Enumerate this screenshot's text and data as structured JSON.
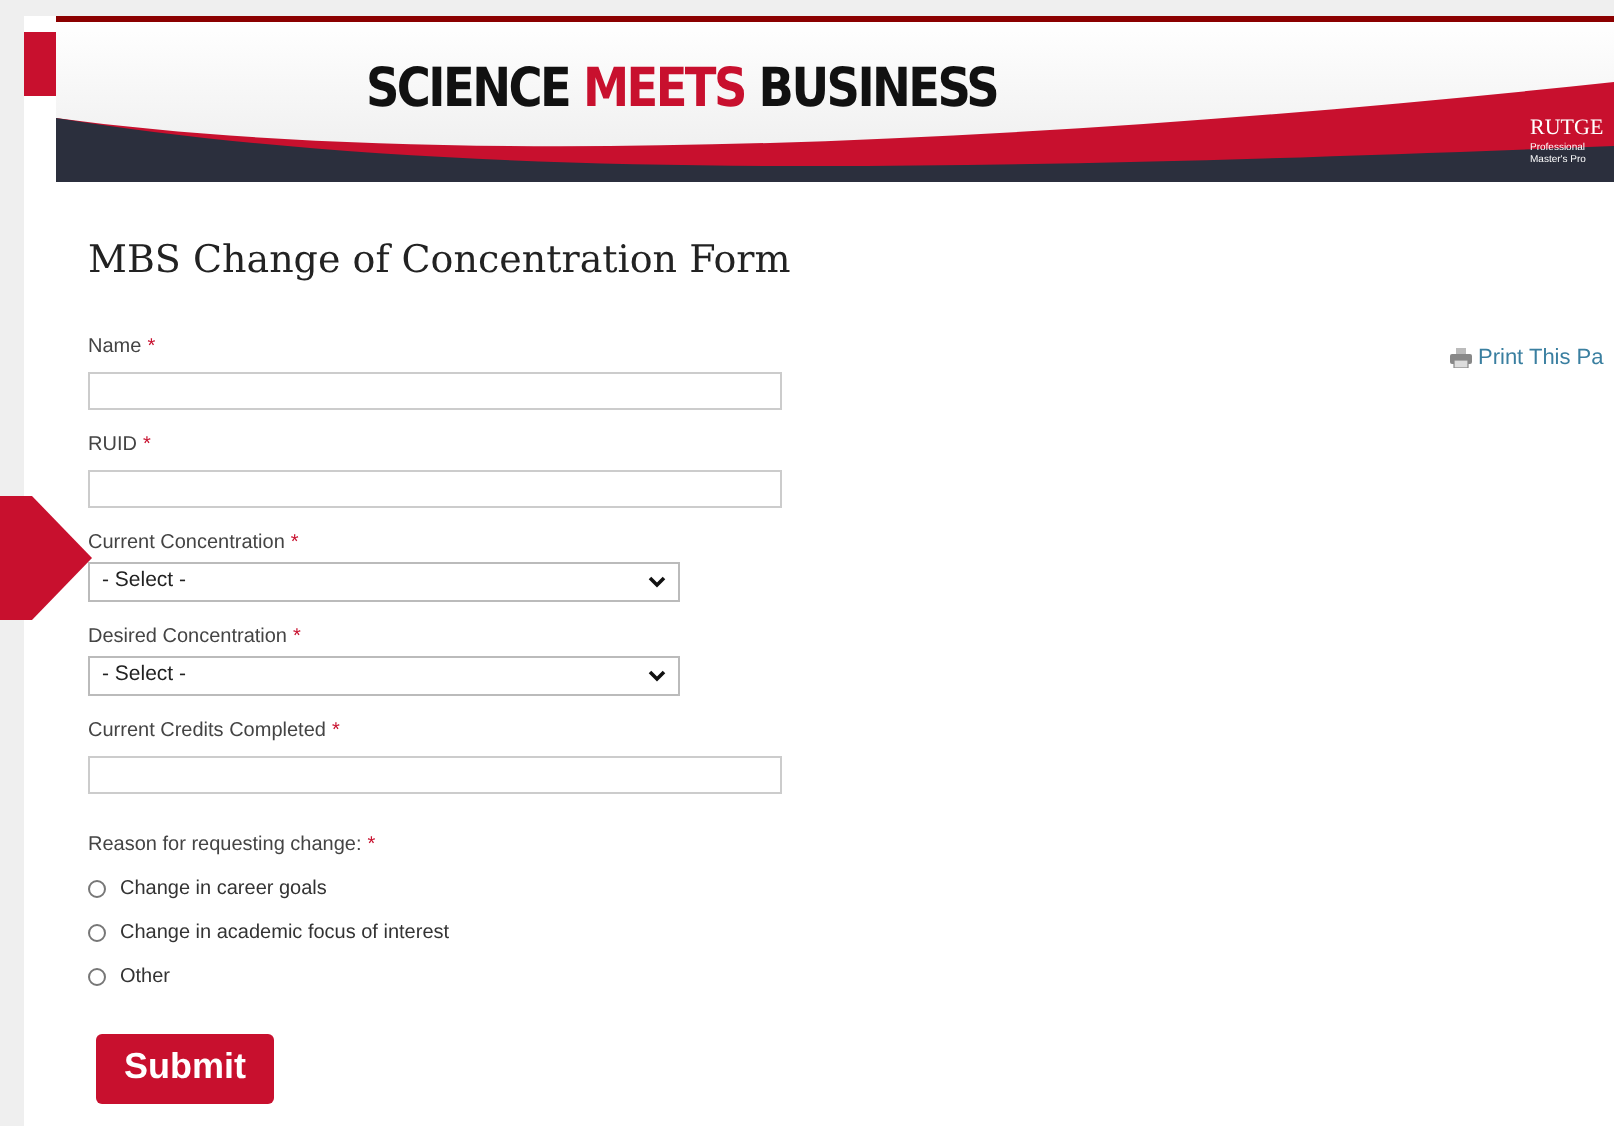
{
  "header": {
    "title_parts": [
      {
        "text": "SCIENCE",
        "accent": false
      },
      {
        "text": "MEETS",
        "accent": true
      },
      {
        "text": "BUSINESS",
        "accent": false
      }
    ],
    "logo": {
      "name": "RUTGE",
      "lines": [
        "Professional",
        "Master's Pro"
      ]
    }
  },
  "page_title": "MBS Change of Concentration Form",
  "print_link": "Print This Pa",
  "fields": [
    {
      "kind": "text",
      "label": "Name",
      "required_mark": "*"
    },
    {
      "kind": "text",
      "label": "RUID",
      "required_mark": "*"
    },
    {
      "kind": "select",
      "label": "Current Concentration",
      "required_mark": "*",
      "value": "- Select -"
    },
    {
      "kind": "select",
      "label": "Desired Concentration",
      "required_mark": "*",
      "value": "- Select -"
    },
    {
      "kind": "text",
      "label": "Current Credits Completed",
      "required_mark": "*"
    }
  ],
  "reason": {
    "label": "Reason for requesting change:",
    "required_mark": "*",
    "options": [
      {
        "label": "Change in career goals",
        "selected": false
      },
      {
        "label": "Change in academic focus of interest",
        "selected": false
      },
      {
        "label": "Other",
        "selected": false
      }
    ]
  },
  "submit": "Submit"
}
